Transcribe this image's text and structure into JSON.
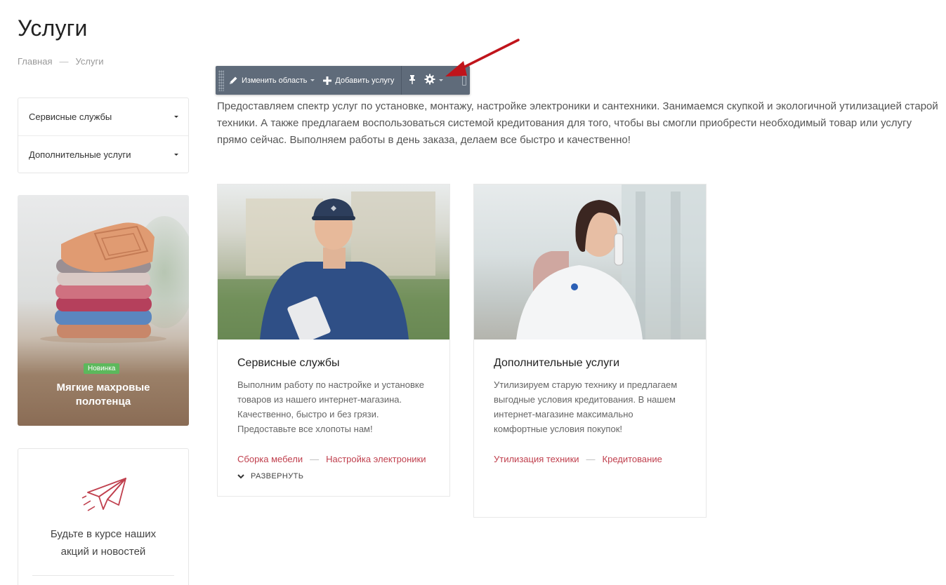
{
  "page": {
    "title": "Услуги"
  },
  "breadcrumb": {
    "home": "Главная",
    "separator": "—",
    "current": "Услуги"
  },
  "sidebar": {
    "items": [
      {
        "label": "Сервисные службы"
      },
      {
        "label": "Дополнительные услуги"
      }
    ]
  },
  "promo": {
    "badge": "Новинка",
    "title": "Мягкие махровые полотенца"
  },
  "subscribe": {
    "text": "Будьте в курсе наших акций и новостей"
  },
  "toolbar": {
    "edit_area_label": "Изменить область",
    "add_service_label": "Добавить услугу",
    "icons": [
      "pencil-icon",
      "plus-icon",
      "pin-icon",
      "gear-icon"
    ]
  },
  "intro": "Предоставляем спектр услуг по установке, монтажу, настройке электроники и сантехники. Занимаемся скупкой и экологичной утилизацией старой техники. А также предлагаем воспользоваться системой кредитования для того, чтобы вы смогли приобрести необходимый товар или услугу прямо сейчас. Выполняем работы в день заказа, делаем все быстро и качественно!",
  "cards": [
    {
      "title": "Сервисные службы",
      "description": "Выполним работу по настройке и установке товаров из нашего интернет-магазина. Качественно, быстро и без грязи. Предоставьте все хлопоты нам!",
      "links": [
        "Сборка мебели",
        "Настройка электроники"
      ],
      "link_separator": "—",
      "expand_label": "РАЗВЕРНУТЬ"
    },
    {
      "title": "Дополнительные услуги",
      "description": "Утилизируем старую технику и предлагаем выгодные условия кредитования. В нашем интернет-магазине максимально комфортные условия покупок!",
      "links": [
        "Утилизация техники",
        "Кредитование"
      ],
      "link_separator": "—"
    }
  ],
  "colors": {
    "accent_link": "#c0404e",
    "badge_green": "#5cb85c",
    "toolbar_bg": "#5f6b7a",
    "arrow_red": "#c0141b"
  }
}
